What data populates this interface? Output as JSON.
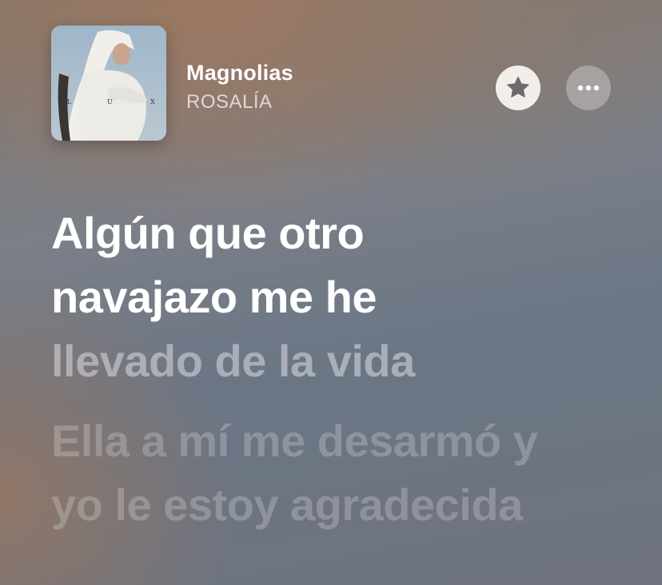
{
  "track": {
    "title": "Magnolias",
    "artist": "ROSALÍA",
    "album_art_letters": [
      "L",
      "U",
      "X"
    ]
  },
  "controls": {
    "favorite_icon": "star-icon",
    "more_icon": "ellipsis-icon"
  },
  "lyrics": {
    "current": {
      "sung_lines": [
        "Algún que otro",
        "navajazo me he"
      ],
      "pending_line": "llevado de la vida"
    },
    "next": [
      "Ella a mí me desarmó y",
      "yo le estoy agradecida"
    ]
  },
  "colors": {
    "active_lyric": "#ffffff",
    "favorite_button_bg": "#f8f4f0",
    "star_fill": "#6e6a6c"
  }
}
